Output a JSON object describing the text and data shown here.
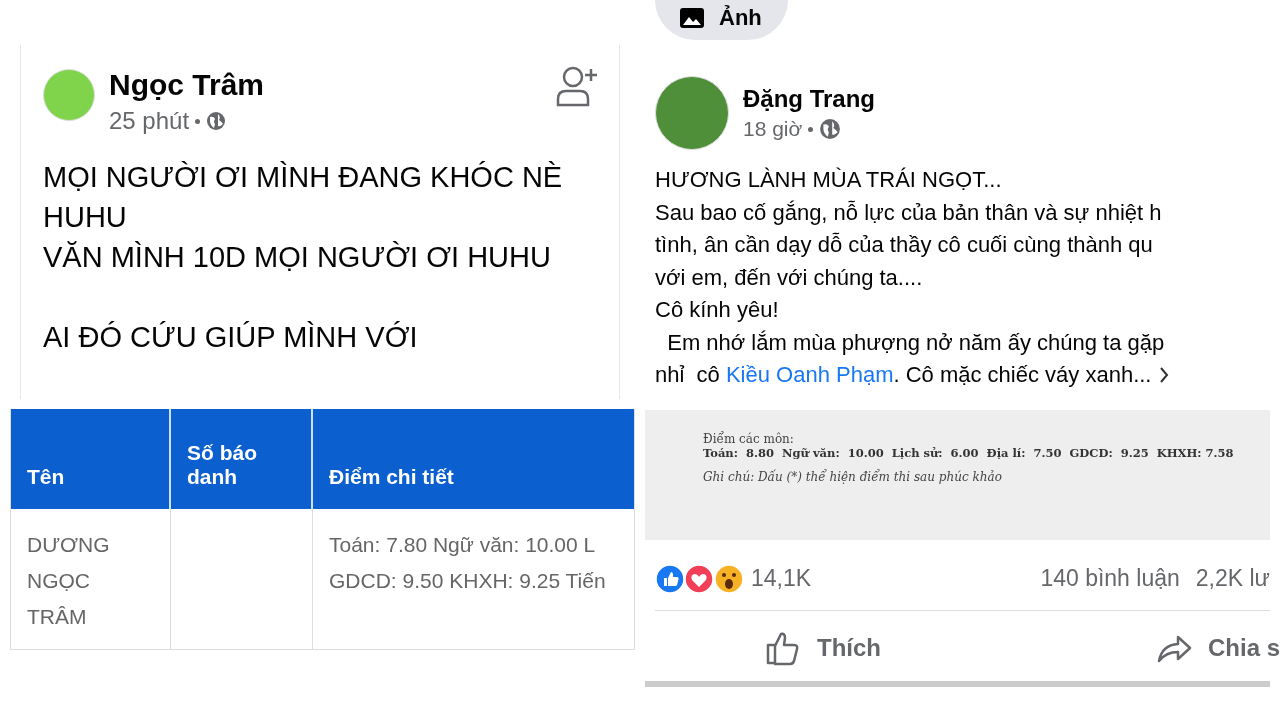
{
  "left_post": {
    "author": "Ngọc Trâm",
    "time": "25 phút",
    "paragraphs": [
      [
        "MỌI NGƯỜI ƠI MÌNH ĐANG KHÓC NÈ",
        "HUHU",
        "VĂN MÌNH 10D MỌI NGƯỜI ƠI HUHU"
      ],
      [
        "AI ĐÓ CỨU GIÚP MÌNH VỚI"
      ]
    ],
    "table": {
      "columns": [
        "Tên",
        "Số báo danh",
        "Điểm chi tiết"
      ],
      "rows": [
        {
          "cells": [
            [
              "DƯƠNG",
              "NGỌC",
              "TRÂM"
            ],
            [],
            [
              "Toán: 7.80 Ngữ văn: 10.00 L",
              "GDCD: 9.50 KHXH: 9.25 Tiến"
            ]
          ]
        }
      ]
    }
  },
  "right_post": {
    "photo_button": "Ảnh",
    "author": "Đặng Trang",
    "time": "18 giờ",
    "lines": [
      [
        {
          "text": "HƯƠNG LÀNH MÙA TRÁI NGỌT..."
        }
      ],
      [
        {
          "text": "Sau bao cố gắng, nỗ lực của bản thân và sự nhiệt h"
        }
      ],
      [
        {
          "text": "tình, ân cần dạy dỗ của thầy cô cuối cùng thành qu"
        }
      ],
      [
        {
          "text": "với em, đến với chúng ta...."
        }
      ],
      [
        {
          "text": "Cô kính yêu!"
        }
      ],
      [
        {
          "text": "  Em nhớ lắm mùa phượng nở năm ấy chúng ta gặp"
        }
      ],
      [
        {
          "text": "nhỉ  cô "
        },
        {
          "text": "Kiều Oanh Phạm",
          "kind": "link"
        },
        {
          "text": ". Cô mặc chiếc váy xanh..."
        }
      ]
    ],
    "score_image": {
      "heading": "Điểm các môn:",
      "scores": "Toán:  8.80  Ngữ văn:  10.00  Lịch sử:  6.00  Địa lí:  7.50  GDCD:  9.25  KHXH: 7.58",
      "note": "Ghi chú: Dấu (*) thể hiện điểm thi sau phúc khảo"
    },
    "reactions": "14,1K",
    "comments": "140 bình luận",
    "shares": "2,2K lư",
    "actions": [
      "Thích",
      "Chia s"
    ]
  }
}
